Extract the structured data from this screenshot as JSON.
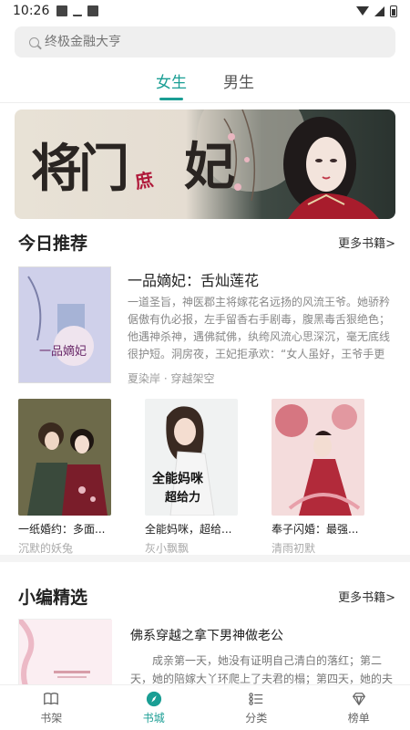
{
  "status_bar": {
    "time": "10:26"
  },
  "search": {
    "placeholder": "终极金融大亨"
  },
  "gender_tabs": [
    {
      "label": "女生",
      "active": true
    },
    {
      "label": "男生",
      "active": false
    }
  ],
  "banner": {
    "calligraphy_main": "将门",
    "calligraphy_small": "庶",
    "calligraphy_end": "妃"
  },
  "today": {
    "title": "今日推荐",
    "more": "更多书籍>",
    "feature": {
      "title": "一品嫡妃：舌灿莲花",
      "description": "一道圣旨，神医郡主将嫁花名远扬的风流王爷。她骄矜倨傲有仇必报，左手留香右手剧毒，腹黑毒舌狠绝色；他遇神杀神，遇佛弑佛，纨绔风流心思深沉，毫无底线很护短。洞房夜，王妃拒承欢：“女人虽好，王爷手更",
      "meta": "夏染岸 · 穿越架空"
    },
    "books": [
      {
        "title": "一纸婚约：多面...",
        "author": "沉默的妖兔"
      },
      {
        "title": "全能妈咪，超给...",
        "author": "灰小飘飘"
      },
      {
        "title": "奉子闪婚：最强...",
        "author": "清雨初默"
      }
    ]
  },
  "editor_pick": {
    "title": "小编精选",
    "more": "更多书籍>",
    "book": {
      "title": "佛系穿越之拿下男神做老公",
      "description": "成亲第一天，她没有证明自己清白的落红；第二天，她的陪嫁大丫环爬上了夫君的榻；第四天，她的夫君联"
    }
  },
  "bottom_nav": [
    {
      "label": "书架",
      "active": false
    },
    {
      "label": "书城",
      "active": true
    },
    {
      "label": "分类",
      "active": false
    },
    {
      "label": "榜单",
      "active": false
    }
  ],
  "colors": {
    "accent": "#1a9e94",
    "text": "#222222",
    "muted": "#999999"
  }
}
